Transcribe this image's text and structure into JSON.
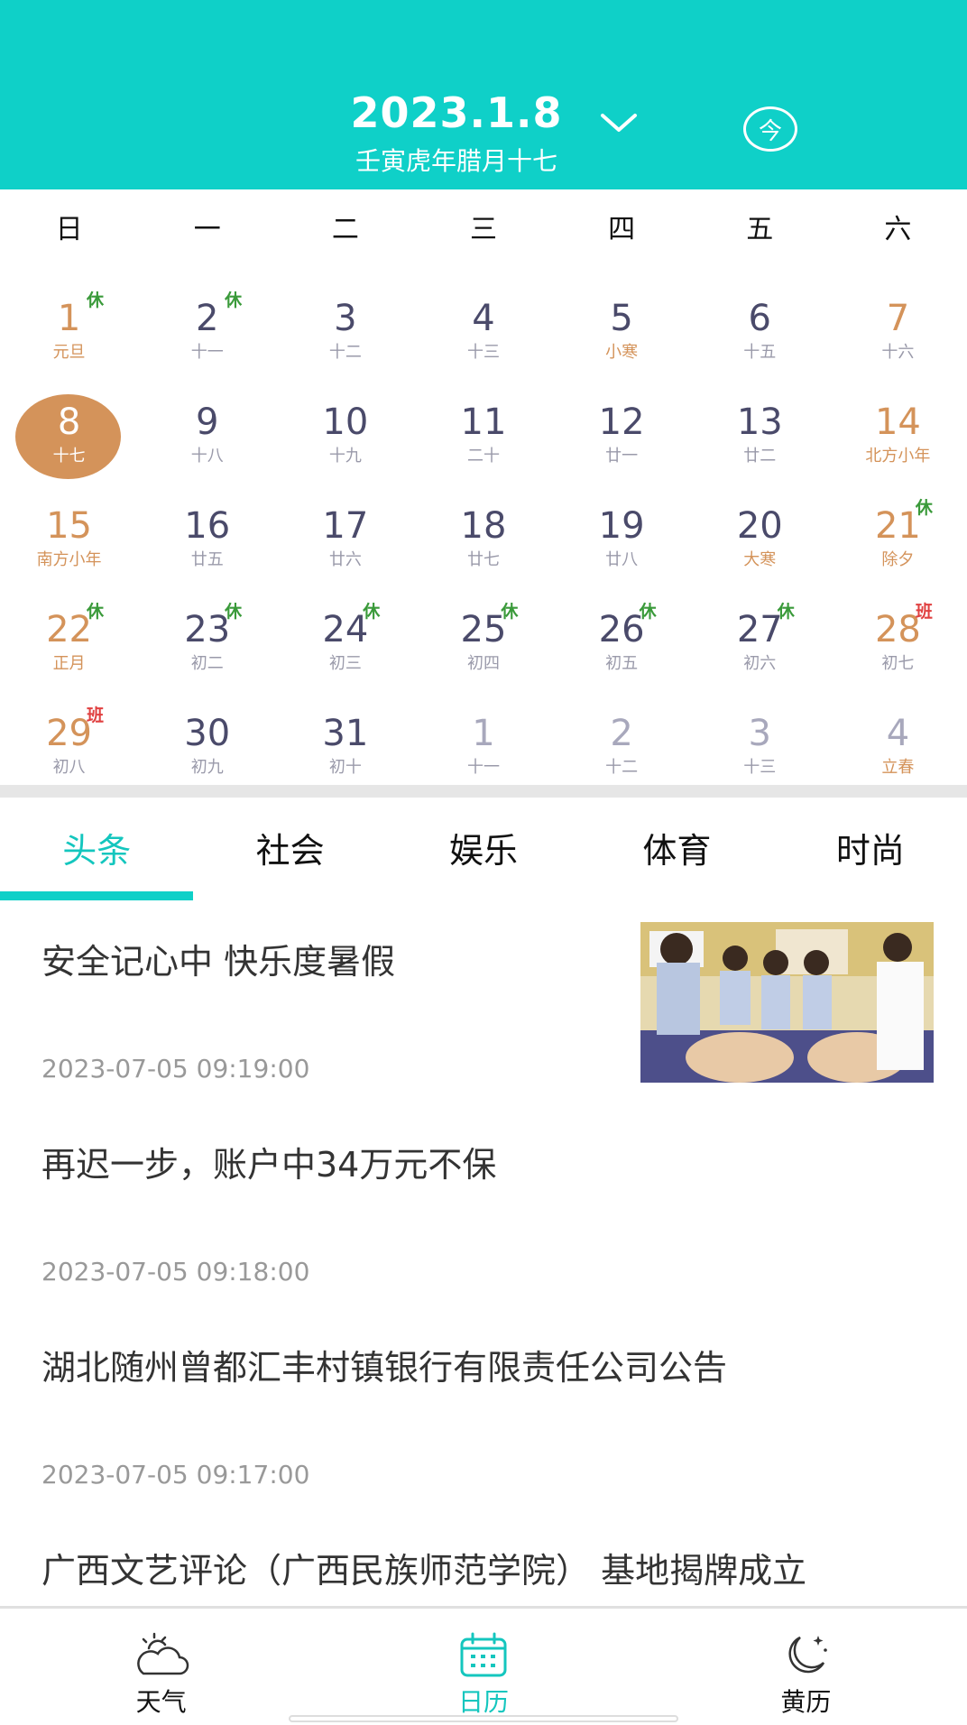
{
  "header": {
    "date": "2023.1.8",
    "lunar_date": "壬寅虎年腊月十七",
    "today_label": "今",
    "colors": {
      "primary": "#0fd0c8",
      "accent_orange": "#d4935a",
      "rest_green": "#3a9a3a",
      "work_red": "#e04040"
    }
  },
  "weekdays": [
    "日",
    "一",
    "二",
    "三",
    "四",
    "五",
    "六"
  ],
  "calendar": {
    "days": [
      {
        "num": "1",
        "lunar": "元旦",
        "badge": "休",
        "badge_type": "rest",
        "style": "orange orange-lunar"
      },
      {
        "num": "2",
        "lunar": "十一",
        "badge": "休",
        "badge_type": "rest",
        "style": ""
      },
      {
        "num": "3",
        "lunar": "十二",
        "badge": "",
        "badge_type": "",
        "style": ""
      },
      {
        "num": "4",
        "lunar": "十三",
        "badge": "",
        "badge_type": "",
        "style": ""
      },
      {
        "num": "5",
        "lunar": "小寒",
        "badge": "",
        "badge_type": "",
        "style": "orange-lunar"
      },
      {
        "num": "6",
        "lunar": "十五",
        "badge": "",
        "badge_type": "",
        "style": ""
      },
      {
        "num": "7",
        "lunar": "十六",
        "badge": "",
        "badge_type": "",
        "style": "orange"
      },
      {
        "num": "8",
        "lunar": "十七",
        "badge": "",
        "badge_type": "",
        "style": "selected"
      },
      {
        "num": "9",
        "lunar": "十八",
        "badge": "",
        "badge_type": "",
        "style": ""
      },
      {
        "num": "10",
        "lunar": "十九",
        "badge": "",
        "badge_type": "",
        "style": ""
      },
      {
        "num": "11",
        "lunar": "二十",
        "badge": "",
        "badge_type": "",
        "style": ""
      },
      {
        "num": "12",
        "lunar": "廿一",
        "badge": "",
        "badge_type": "",
        "style": ""
      },
      {
        "num": "13",
        "lunar": "廿二",
        "badge": "",
        "badge_type": "",
        "style": ""
      },
      {
        "num": "14",
        "lunar": "北方小年",
        "badge": "",
        "badge_type": "",
        "style": "orange orange-lunar"
      },
      {
        "num": "15",
        "lunar": "南方小年",
        "badge": "",
        "badge_type": "",
        "style": "orange orange-lunar"
      },
      {
        "num": "16",
        "lunar": "廿五",
        "badge": "",
        "badge_type": "",
        "style": ""
      },
      {
        "num": "17",
        "lunar": "廿六",
        "badge": "",
        "badge_type": "",
        "style": ""
      },
      {
        "num": "18",
        "lunar": "廿七",
        "badge": "",
        "badge_type": "",
        "style": ""
      },
      {
        "num": "19",
        "lunar": "廿八",
        "badge": "",
        "badge_type": "",
        "style": ""
      },
      {
        "num": "20",
        "lunar": "大寒",
        "badge": "",
        "badge_type": "",
        "style": "orange-lunar"
      },
      {
        "num": "21",
        "lunar": "除夕",
        "badge": "休",
        "badge_type": "rest",
        "style": "orange orange-lunar"
      },
      {
        "num": "22",
        "lunar": "正月",
        "badge": "休",
        "badge_type": "rest",
        "style": "orange orange-lunar"
      },
      {
        "num": "23",
        "lunar": "初二",
        "badge": "休",
        "badge_type": "rest",
        "style": ""
      },
      {
        "num": "24",
        "lunar": "初三",
        "badge": "休",
        "badge_type": "rest",
        "style": ""
      },
      {
        "num": "25",
        "lunar": "初四",
        "badge": "休",
        "badge_type": "rest",
        "style": ""
      },
      {
        "num": "26",
        "lunar": "初五",
        "badge": "休",
        "badge_type": "rest",
        "style": ""
      },
      {
        "num": "27",
        "lunar": "初六",
        "badge": "休",
        "badge_type": "rest",
        "style": ""
      },
      {
        "num": "28",
        "lunar": "初七",
        "badge": "班",
        "badge_type": "work",
        "style": "orange"
      },
      {
        "num": "29",
        "lunar": "初八",
        "badge": "班",
        "badge_type": "work",
        "style": "orange"
      },
      {
        "num": "30",
        "lunar": "初九",
        "badge": "",
        "badge_type": "",
        "style": ""
      },
      {
        "num": "31",
        "lunar": "初十",
        "badge": "",
        "badge_type": "",
        "style": ""
      },
      {
        "num": "1",
        "lunar": "十一",
        "badge": "",
        "badge_type": "",
        "style": "other"
      },
      {
        "num": "2",
        "lunar": "十二",
        "badge": "",
        "badge_type": "",
        "style": "other"
      },
      {
        "num": "3",
        "lunar": "十三",
        "badge": "",
        "badge_type": "",
        "style": "other"
      },
      {
        "num": "4",
        "lunar": "立春",
        "badge": "",
        "badge_type": "",
        "style": "other orange-lunar"
      }
    ]
  },
  "tabs": [
    {
      "label": "头条",
      "active": true
    },
    {
      "label": "社会",
      "active": false
    },
    {
      "label": "娱乐",
      "active": false
    },
    {
      "label": "体育",
      "active": false
    },
    {
      "label": "时尚",
      "active": false
    }
  ],
  "news": [
    {
      "title": "安全记心中  快乐度暑假",
      "time": "2023-07-05  09:19:00",
      "has_image": true
    },
    {
      "title": "再迟一步，账户中34万元不保",
      "time": "2023-07-05  09:18:00",
      "has_image": false
    },
    {
      "title": "湖北随州曾都汇丰村镇银行有限责任公司公告",
      "time": "2023-07-05  09:17:00",
      "has_image": false
    },
    {
      "title": "广西文艺评论（广西民族师范学院） 基地揭牌成立",
      "time": "",
      "has_image": false
    }
  ],
  "bottom_nav": [
    {
      "label": "天气",
      "icon": "weather-cloud-sun-icon",
      "active": false
    },
    {
      "label": "日历",
      "icon": "calendar-icon",
      "active": true
    },
    {
      "label": "黄历",
      "icon": "moon-stars-icon",
      "active": false
    }
  ]
}
